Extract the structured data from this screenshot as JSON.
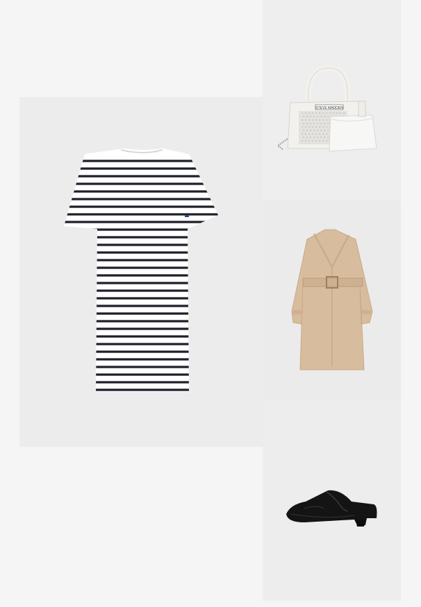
{
  "outfit": {
    "items": [
      {
        "id": "dress",
        "name": "Striped t-shirt dress",
        "colors": {
          "base": "#ffffff",
          "stripe": "#1d1f2a"
        }
      },
      {
        "id": "bag",
        "name": "Handbag",
        "brand_text": "STEVE MADDEN",
        "colors": {
          "body": "#f3f1ed",
          "pouch": "#f7f7f5"
        }
      },
      {
        "id": "coat",
        "name": "Trench coat",
        "colors": {
          "body": "#d8bc9e",
          "shadow": "#c8a986"
        }
      },
      {
        "id": "shoe",
        "name": "Western mules",
        "colors": {
          "body": "#141414"
        }
      }
    ]
  }
}
